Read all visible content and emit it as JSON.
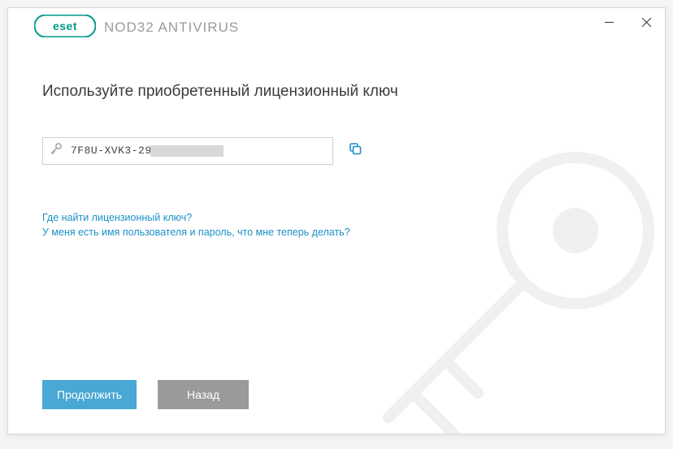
{
  "app": {
    "brand": "ESET",
    "product": "NOD32 ANTIVIRUS"
  },
  "heading": "Используйте приобретенный лицензионный ключ",
  "license_key_visible": "7F8U-XVK3-29",
  "links": {
    "where_is_key": "Где найти лицензионный ключ?",
    "have_credentials": "У меня есть имя пользователя и пароль, что мне теперь делать?"
  },
  "buttons": {
    "continue": "Продолжить",
    "back": "Назад"
  },
  "icons": {
    "key": "key-icon",
    "copy": "copy-icon",
    "minimize": "minimize-icon",
    "close": "close-icon"
  },
  "colors": {
    "brand": "#00998a",
    "link": "#1a90c9",
    "primary_btn": "#49a8d4",
    "secondary_btn": "#9a9a9a"
  }
}
